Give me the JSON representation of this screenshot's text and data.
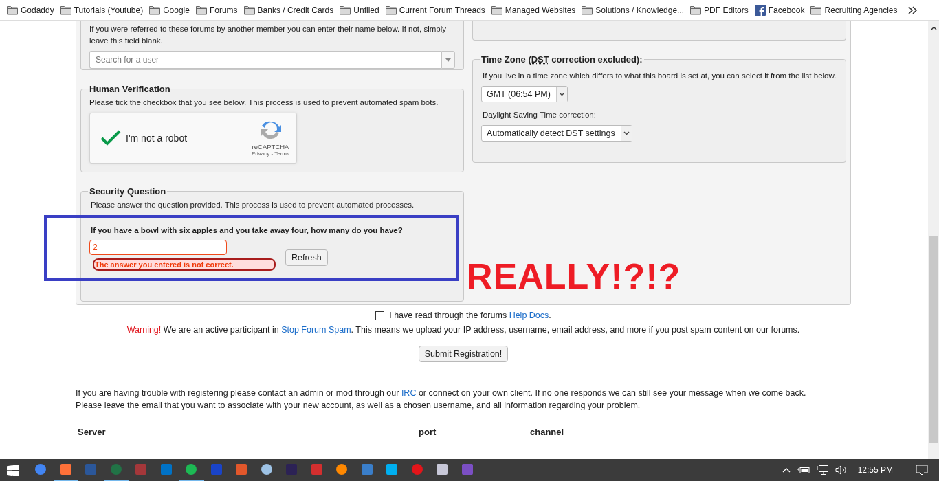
{
  "bookmarks": [
    {
      "label": "Godaddy",
      "kind": "folder"
    },
    {
      "label": "Tutorials (Youtube)",
      "kind": "folder"
    },
    {
      "label": "Google",
      "kind": "folder"
    },
    {
      "label": "Forums",
      "kind": "folder"
    },
    {
      "label": "Banks / Credit Cards",
      "kind": "folder"
    },
    {
      "label": "Unfiled",
      "kind": "folder"
    },
    {
      "label": "Current Forum Threads",
      "kind": "folder"
    },
    {
      "label": "Managed Websites",
      "kind": "folder"
    },
    {
      "label": "Solutions / Knowledge...",
      "kind": "folder"
    },
    {
      "label": "PDF Editors",
      "kind": "folder"
    },
    {
      "label": "Facebook",
      "kind": "facebook"
    },
    {
      "label": "Recruiting Agencies",
      "kind": "folder"
    }
  ],
  "referral": {
    "text": "If you were referred to these forums by another member you can enter their name below. If not, simply leave this field blank.",
    "user_search": {
      "placeholder": "Search for a user"
    }
  },
  "human_verification": {
    "legend": "Human Verification",
    "text": "Please tick the checkbox that you see below. This process is used to prevent automated spam bots.",
    "captcha": {
      "checked": true,
      "label": "I'm not a robot",
      "brand": "reCAPTCHA",
      "links": "Privacy - Terms"
    }
  },
  "security_question": {
    "legend": "Security Question",
    "text": "Please answer the question provided. This process is used to prevent automated processes.",
    "question": "If you have a bowl with six apples and you take away four, how many do you have?",
    "answer": "2",
    "error": "The answer you entered is not correct.",
    "refresh": "Refresh"
  },
  "time_zone": {
    "legend": {
      "before": "Time Zone (",
      "abbr": "DST",
      "after": " correction excluded):"
    },
    "text": "If you live in a time zone which differs to what this board is set at, you can select it from the list below.",
    "zone_select": {
      "value": "GMT (06:54 PM)"
    },
    "dst_label": "Daylight Saving Time correction:",
    "dst_select": {
      "value": "Automatically detect DST settings"
    }
  },
  "annotation": {
    "text": "REALLY!?!?"
  },
  "agreement": {
    "checked": false,
    "before": "I have read through the forums ",
    "link": "Help Docs",
    "after": "."
  },
  "warning": {
    "label": "Warning!",
    "before": " We are an active participant in ",
    "link": "Stop Forum Spam",
    "after": ". This means we upload your IP address, username, email address, and more if you post spam content on our forums."
  },
  "submit": "Submit Registration!",
  "help": {
    "before": "If you are having trouble with registering please contact an admin or mod through our ",
    "link": "IRC",
    "after": " or connect on your own client. If no one responds we can still see your message when we come back.",
    "line2": "Please leave the email that you want to associate with your new account, as well as a chosen username, and all information regarding your problem."
  },
  "irc_table": {
    "columns": [
      "Server",
      "port",
      "channel"
    ]
  },
  "taskbar": {
    "apps": [
      {
        "active": false
      },
      {
        "active": true
      },
      {
        "active": false
      },
      {
        "active": true
      },
      {
        "active": false
      },
      {
        "active": false
      },
      {
        "active": true
      },
      {
        "active": false
      },
      {
        "active": false
      },
      {
        "active": false
      },
      {
        "active": false
      },
      {
        "active": false
      },
      {
        "active": false
      },
      {
        "active": false
      },
      {
        "active": false
      },
      {
        "active": false
      },
      {
        "active": false
      },
      {
        "active": false
      }
    ],
    "clock": "12:55 PM"
  }
}
